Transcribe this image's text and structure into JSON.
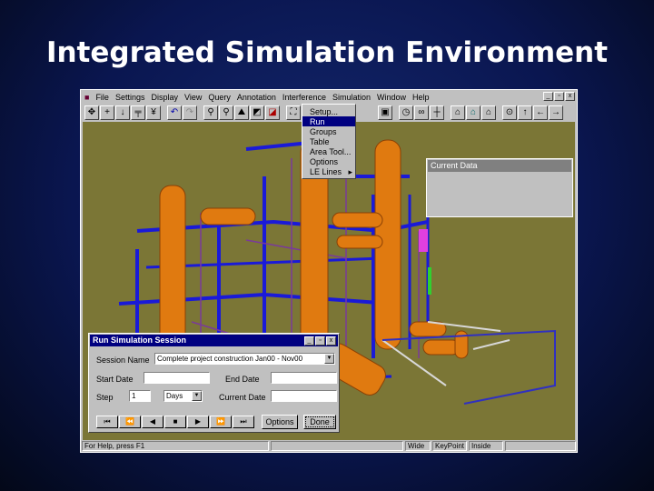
{
  "slide_title": "Integrated Simulation Environment",
  "menubar": [
    "File",
    "Settings",
    "Display",
    "View",
    "Query",
    "Annotation",
    "Interference",
    "Simulation",
    "Window",
    "Help"
  ],
  "window_buttons": [
    "_",
    "▫",
    "x"
  ],
  "simulation_menu": [
    "Setup...",
    "Run",
    "Groups",
    "Table",
    "Area Tool...",
    "Options",
    "LE Lines"
  ],
  "simulation_menu_selected": "Run",
  "data_panel": {
    "title": "Current Data"
  },
  "dialog": {
    "title": "Run Simulation Session",
    "session_name_label": "Session Name",
    "session_name_value": "Complete project construction Jan00 - Nov00",
    "start_date_label": "Start Date",
    "start_date_value": "",
    "end_date_label": "End Date",
    "end_date_value": "",
    "step_label": "Step",
    "step_value": "1",
    "step_unit": "Days",
    "current_date_label": "Current Date",
    "current_date_value": "",
    "playback": [
      "⏮",
      "⏪",
      "◀",
      "■",
      "▶",
      "⏩",
      "⏭"
    ],
    "options_label": "Options",
    "done_label": "Done"
  },
  "status": {
    "help": "For Help, press F1",
    "mode": "Wide",
    "keypoint": "KeyPoint",
    "scale": "Inside"
  },
  "colors": {
    "scene_bg": "#7b7636",
    "pipe": "#e07a10",
    "steel": "#1818d0",
    "title_bar": "#000080"
  }
}
